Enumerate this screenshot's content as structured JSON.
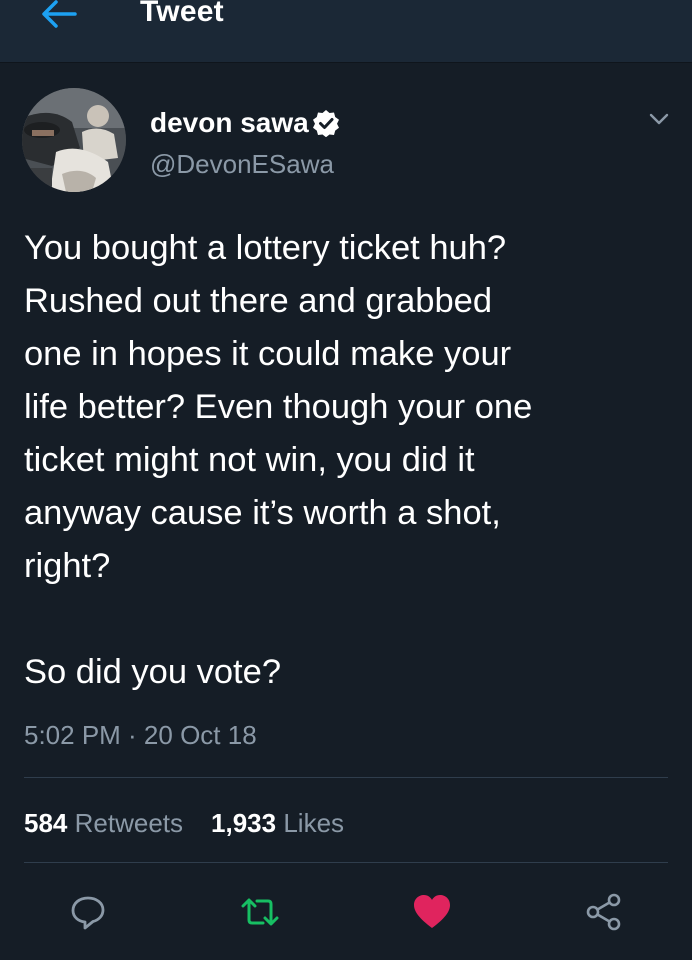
{
  "header": {
    "title": "Tweet",
    "back_icon": "arrow-left-icon",
    "accent_color": "#1da1f2"
  },
  "author": {
    "display_name": "devon sawa",
    "handle": "@DevonESawa",
    "verified": true
  },
  "tweet": {
    "text": "You bought a lottery ticket huh?\nRushed out there and grabbed\none in hopes it could make your\nlife better? Even though your one\nticket might not win, you did it\nanyway cause it’s worth a shot,\nright?\n\nSo did you vote?",
    "timestamp": "5:02 PM · 20 Oct 18"
  },
  "stats": {
    "retweets_count": "584",
    "retweets_label": "Retweets",
    "likes_count": "1,933",
    "likes_label": "Likes"
  },
  "actions": [
    {
      "name": "reply",
      "icon": "reply-icon",
      "color": "#8b99a7"
    },
    {
      "name": "retweet",
      "icon": "retweet-icon",
      "color": "#17bf63"
    },
    {
      "name": "like",
      "icon": "heart-icon",
      "color": "#e0245e"
    },
    {
      "name": "share",
      "icon": "share-icon",
      "color": "#8b99a7"
    }
  ]
}
